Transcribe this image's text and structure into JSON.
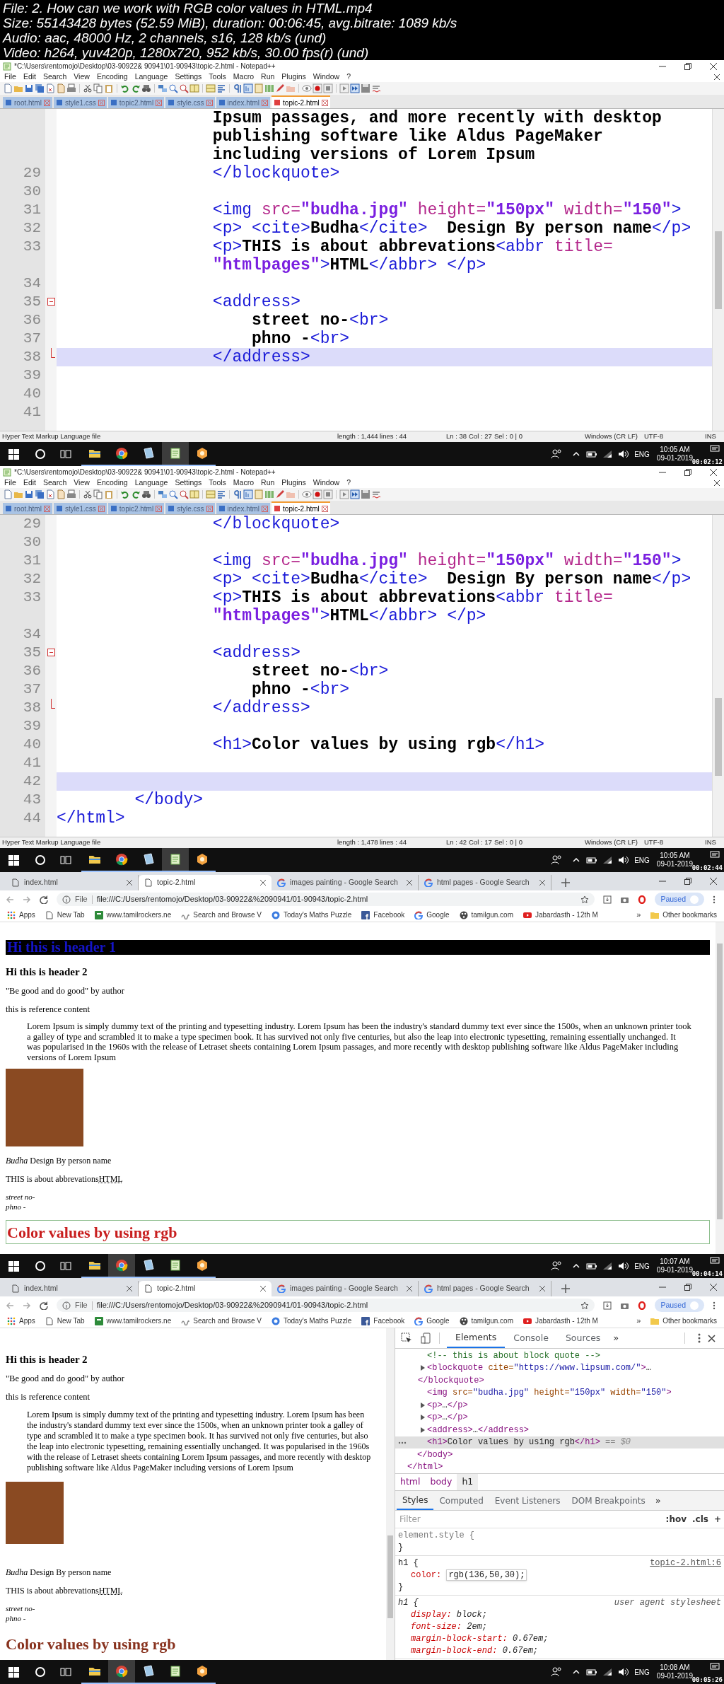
{
  "file_info": [
    "File: 2. How can we work with RGB color values in HTML.mp4",
    "Size: 55143428 bytes (52.59 MiB), duration: 00:06:45, avg.bitrate: 1089 kb/s",
    "Audio: aac, 48000 Hz, 2 channels, s16, 128 kb/s (und)",
    "Video: h264, yuv420p, 1280x720, 952 kb/s, 30.00 fps(r) (und)"
  ],
  "frames": [
    {
      "kind": "notepad",
      "window_title": "*C:\\Users\\rentomojo\\Desktop\\03-90922& 90941\\01-90943\\topic-2.html - Notepad++",
      "menu": [
        "File",
        "Edit",
        "Search",
        "View",
        "Encoding",
        "Language",
        "Settings",
        "Tools",
        "Macro",
        "Run",
        "Plugins",
        "Window",
        "?"
      ],
      "tabs": [
        {
          "label": "root.html",
          "selected": false
        },
        {
          "label": "style1.css",
          "selected": false
        },
        {
          "label": "topic2.html",
          "selected": false
        },
        {
          "label": "style.css",
          "selected": false
        },
        {
          "label": "index.html",
          "selected": false
        },
        {
          "label": "topic-2.html",
          "selected": true
        }
      ],
      "lines": [
        {
          "kind": "code",
          "code": "                Ipsum passages, and more recently with desktop",
          "highlighted": false
        },
        {
          "kind": "code",
          "code": "                publishing software like Aldus PageMaker",
          "highlighted": false
        },
        {
          "kind": "code",
          "code": "                including versions of Lorem Ipsum",
          "highlighted": false
        },
        {
          "kind": "code",
          "number": "29",
          "code": "                </blockquote>",
          "highlighted": false
        },
        {
          "kind": "code",
          "number": "30",
          "highlighted": false
        },
        {
          "kind": "code",
          "number": "31",
          "code": "                <img src=\"budha.jpg\" height=\"150px\" width=\"150\">",
          "highlighted": false
        },
        {
          "kind": "code",
          "number": "32",
          "code": "                <p> <cite>Budha</cite>  Design By person name</p>",
          "highlighted": false
        },
        {
          "kind": "code",
          "number": "33",
          "code": "                <p>THIS is about abbrevations<abbr title=",
          "highlighted": false
        },
        {
          "kind": "code",
          "code": "                \"htmlpages\">HTML</abbr> </p>",
          "highlighted": false
        },
        {
          "kind": "code",
          "number": "34",
          "highlighted": false
        },
        {
          "kind": "fold_start",
          "number": "35",
          "code": "                <address>",
          "highlighted": false
        },
        {
          "kind": "code",
          "number": "36",
          "code": "                    street no-<br>",
          "highlighted": false
        },
        {
          "kind": "code",
          "number": "37",
          "code": "                    phno -<br>",
          "highlighted": false
        },
        {
          "kind": "fold_end",
          "number": "38",
          "code": "                </address>",
          "highlighted": true
        },
        {
          "kind": "code",
          "number": "39",
          "highlighted": false
        },
        {
          "kind": "code",
          "number": "40",
          "highlighted": false
        },
        {
          "kind": "code",
          "number": "41",
          "highlighted": false
        }
      ],
      "status": [
        "Hyper Text Markup Language file",
        "length : 1,444",
        "lines : 44",
        "Ln : 38",
        "Col : 27",
        "Sel : 0 | 0",
        "Windows (CR LF)",
        "UTF-8",
        "INS"
      ],
      "taskbar": {
        "apps": [
          {
            "kind": "explorer",
            "selected": false
          },
          {
            "kind": "chrome",
            "selected": false
          },
          {
            "kind": "tablet",
            "selected": false
          },
          {
            "kind": "notepad",
            "selected": true
          },
          {
            "kind": "hexagon",
            "selected": false
          }
        ],
        "language": "ENG",
        "time": "10:05 AM",
        "date": "09-01-2019"
      },
      "timestamp": "00:02:12"
    },
    {
      "kind": "notepad",
      "window_title": "*C:\\Users\\rentomojo\\Desktop\\03-90922& 90941\\01-90943\\topic-2.html - Notepad++",
      "menu": [
        "File",
        "Edit",
        "Search",
        "View",
        "Encoding",
        "Language",
        "Settings",
        "Tools",
        "Macro",
        "Run",
        "Plugins",
        "Window",
        "?"
      ],
      "tabs": [
        {
          "label": "root.html",
          "selected": false
        },
        {
          "label": "style1.css",
          "selected": false
        },
        {
          "label": "topic2.html",
          "selected": false
        },
        {
          "label": "style.css",
          "selected": false
        },
        {
          "label": "index.html",
          "selected": false
        },
        {
          "label": "topic-2.html",
          "selected": true
        }
      ],
      "lines": [
        {
          "kind": "code",
          "number": "29",
          "code": "                </blockquote>",
          "highlighted": false
        },
        {
          "kind": "code",
          "number": "30",
          "highlighted": false
        },
        {
          "kind": "code",
          "number": "31",
          "code": "                <img src=\"budha.jpg\" height=\"150px\" width=\"150\">",
          "highlighted": false
        },
        {
          "kind": "code",
          "number": "32",
          "code": "                <p> <cite>Budha</cite>  Design By person name</p>",
          "highlighted": false
        },
        {
          "kind": "code",
          "number": "33",
          "code": "                <p>THIS is about abbrevations<abbr title=",
          "highlighted": false
        },
        {
          "kind": "code",
          "code": "                \"htmlpages\">HTML</abbr> </p>",
          "highlighted": false
        },
        {
          "kind": "code",
          "number": "34",
          "highlighted": false
        },
        {
          "kind": "fold_start",
          "number": "35",
          "code": "                <address>",
          "highlighted": false
        },
        {
          "kind": "code",
          "number": "36",
          "code": "                    street no-<br>",
          "highlighted": false
        },
        {
          "kind": "code",
          "number": "37",
          "code": "                    phno -<br>",
          "highlighted": false
        },
        {
          "kind": "fold_end",
          "number": "38",
          "code": "                </address>",
          "highlighted": false
        },
        {
          "kind": "code",
          "number": "39",
          "highlighted": false
        },
        {
          "kind": "code",
          "number": "40",
          "code": "                <h1>Color values by using rgb</h1>",
          "highlighted": false
        },
        {
          "kind": "code",
          "number": "41",
          "highlighted": false
        },
        {
          "kind": "code",
          "number": "42",
          "highlighted": true
        },
        {
          "kind": "code",
          "number": "43",
          "code": "        </body>",
          "highlighted": false
        },
        {
          "kind": "code",
          "number": "44",
          "code": "</html>",
          "highlighted": false
        }
      ],
      "status": [
        "Hyper Text Markup Language file",
        "length : 1,478",
        "lines : 44",
        "Ln : 42",
        "Col : 17",
        "Sel : 0 | 0",
        "Windows (CR LF)",
        "UTF-8",
        "INS"
      ],
      "taskbar": {
        "apps": [
          {
            "kind": "explorer",
            "selected": false
          },
          {
            "kind": "chrome",
            "selected": false
          },
          {
            "kind": "tablet",
            "selected": false
          },
          {
            "kind": "notepad",
            "selected": true
          },
          {
            "kind": "hexagon",
            "selected": false
          }
        ],
        "language": "ENG",
        "time": "10:05 AM",
        "date": "09-01-2019"
      },
      "timestamp": "00:02:44"
    },
    {
      "kind": "chrome",
      "tabs": [
        {
          "label": "index.html",
          "selected": false
        },
        {
          "label": "topic-2.html",
          "selected": true
        },
        {
          "label": "images painting - Google Search",
          "selected": false
        },
        {
          "label": "html pages - Google Search",
          "selected": false
        }
      ],
      "address": {
        "chip": "File",
        "url": "file:///C:/Users/rentomojo/Desktop/03-90922&%2090941/01-90943/topic-2.html"
      },
      "profile_button": "Paused",
      "bookmarks": [
        "Apps",
        "New Tab",
        "www.tamilrockers.ne",
        "Search and Browse V",
        "Today's Maths Puzzle",
        "Facebook",
        "Google",
        "tamilgun.com",
        "Jabardasth - 12th M"
      ],
      "bookmarks_more": "»",
      "other_bookmarks": "Other bookmarks",
      "page": [
        {
          "kind": "h1_bar",
          "text": "Hi this is header 1"
        },
        {
          "kind": "h2",
          "text": "Hi this is header 2"
        },
        {
          "kind": "p",
          "text": "\"Be good and do good\" by author"
        },
        {
          "kind": "p",
          "text": "this is reference content"
        },
        {
          "kind": "blockquote",
          "text": "Lorem Ipsum is simply dummy text of the printing and typesetting industry. Lorem Ipsum has been the industry's standard dummy text ever since the 1500s, when an unknown printer took a galley of type and scrambled it to make a type specimen book. It has survived not only five centuries, but also the leap into electronic typesetting, remaining essentially unchanged. It was popularised in the 1960s with the release of Letraset sheets containing Lorem Ipsum passages, and more recently with desktop publishing software like Aldus PageMaker including versions of Lorem Ipsum"
        },
        {
          "kind": "image"
        },
        {
          "kind": "cite_line",
          "text": "*Budha* Design By person name"
        },
        {
          "kind": "abbr_line",
          "text": "THIS is about abbrevations",
          "abbr": "HTML"
        },
        {
          "kind": "address",
          "lines": [
            "street no-",
            "phno -"
          ]
        },
        {
          "kind": "h1",
          "text": "Color values by using rgb",
          "color": "#c81e1e",
          "outlined": true
        }
      ],
      "taskbar": {
        "apps": [
          {
            "kind": "explorer",
            "selected": false
          },
          {
            "kind": "chrome",
            "selected": true
          },
          {
            "kind": "tablet",
            "selected": false
          },
          {
            "kind": "notepad",
            "selected": false
          },
          {
            "kind": "hexagon",
            "selected": false
          }
        ],
        "language": "ENG",
        "time": "10:07 AM",
        "date": "09-01-2019"
      },
      "timestamp": "00:04:14"
    },
    {
      "kind": "chrome",
      "tabs": [
        {
          "label": "index.html",
          "selected": false
        },
        {
          "label": "topic-2.html",
          "selected": true
        },
        {
          "label": "images painting - Google Search",
          "selected": false
        },
        {
          "label": "html pages - Google Search",
          "selected": false
        }
      ],
      "address": {
        "chip": "File",
        "url": "file:///C:/Users/rentomojo/Desktop/03-90922&%2090941/01-90943/topic-2.html"
      },
      "profile_button": "Paused",
      "bookmarks": [
        "Apps",
        "New Tab",
        "www.tamilrockers.ne",
        "Search and Browse V",
        "Today's Maths Puzzle",
        "Facebook",
        "Google",
        "tamilgun.com",
        "Jabardasth - 12th M"
      ],
      "bookmarks_more": "»",
      "other_bookmarks": "Other bookmarks",
      "page": [
        {
          "kind": "h2",
          "text": "Hi this is header 2"
        },
        {
          "kind": "p",
          "text": "\"Be good and do good\" by author"
        },
        {
          "kind": "p",
          "text": "this is reference content"
        },
        {
          "kind": "blockquote",
          "text": "Lorem Ipsum is simply dummy text of the printing and typesetting industry. Lorem Ipsum has been the industry's standard dummy text ever since the 1500s, when an unknown printer took a galley of type and scrambled it to make a type specimen book. It has survived not only five centuries, but also the leap into electronic typesetting, remaining essentially unchanged. It was popularised in the 1960s with the release of Letraset sheets containing Lorem Ipsum passages, and more recently with desktop publishing software like Aldus PageMaker including versions of Lorem Ipsum"
        },
        {
          "kind": "image"
        },
        {
          "kind": "cite_line",
          "text": "*Budha* Design By person name"
        },
        {
          "kind": "abbr_line",
          "text": "THIS is about abbrevations",
          "abbr": "HTML"
        },
        {
          "kind": "address",
          "lines": [
            "street no-",
            "phno -"
          ]
        },
        {
          "kind": "h1",
          "text": "Color values by using rgb",
          "color": "#88321e",
          "outlined": false
        }
      ],
      "devtools": {
        "tabs": [
          {
            "label": "Elements",
            "selected": true
          },
          {
            "label": "Console",
            "selected": false
          },
          {
            "label": "Sources",
            "selected": false
          }
        ],
        "tabs_more": "»",
        "dom_tree": [
          {
            "closing": "</html>",
            "expandable": false,
            "selected": false,
            "children": [
              {
                "closing": "</body>",
                "expandable": false,
                "selected": false,
                "children": [
                  {
                    "code": "<!-- this is about block quote -->",
                    "expandable": false,
                    "selected": false
                  },
                  {
                    "code": "<blockquote cite=\"https://www.lipsum.com/\">…",
                    "closing": "</blockquote>",
                    "expandable": true,
                    "selected": false
                  },
                  {
                    "code": "<img src=\"budha.jpg\" height=\"150px\" width=\"150\">",
                    "expandable": false,
                    "selected": false
                  },
                  {
                    "code": "<p>…</p>",
                    "expandable": true,
                    "selected": false
                  },
                  {
                    "code": "<p>…</p>",
                    "expandable": true,
                    "selected": false
                  },
                  {
                    "code": "<address>…</address>",
                    "expandable": true,
                    "selected": false
                  },
                  {
                    "code": "<h1>Color values by using rgb</h1>",
                    "suffix": "== $0",
                    "expandable": false,
                    "selected": true
                  }
                ]
              }
            ]
          }
        ],
        "breadcrumbs": [
          {
            "label": "html",
            "selected": false
          },
          {
            "label": "body",
            "selected": false
          },
          {
            "label": "h1",
            "selected": true
          }
        ],
        "style_tabs": [
          {
            "label": "Styles",
            "selected": true
          },
          {
            "label": "Computed",
            "selected": false
          },
          {
            "label": "Event Listeners",
            "selected": false
          },
          {
            "label": "DOM Breakpoints",
            "selected": false
          }
        ],
        "style_tabs_more": "»",
        "filter": {
          "placeholder": "Filter",
          "buttons": [
            ":hov",
            ".cls",
            "+"
          ]
        },
        "rules": [
          {
            "kind": "inline",
            "selector": "element.style {",
            "closing": "}"
          },
          {
            "kind": "author",
            "selector": "h1 {",
            "source": "topic-2.html:6",
            "declarations": [
              {
                "property": "color:",
                "value": "rgb(136,50,30);",
                "editing": true
              }
            ],
            "closing": "}"
          },
          {
            "kind": "user_agent",
            "selector": "h1 {",
            "source": "user agent stylesheet",
            "declarations": [
              {
                "property": "display:",
                "value": "block;",
                "editing": false
              },
              {
                "property": "font-size:",
                "value": "2em;",
                "editing": false
              },
              {
                "property": "margin-block-start:",
                "value": "0.67em;",
                "editing": false
              },
              {
                "property": "margin-block-end:",
                "value": "0.67em;",
                "editing": false
              }
            ]
          }
        ]
      },
      "taskbar": {
        "apps": [
          {
            "kind": "explorer",
            "selected": false
          },
          {
            "kind": "chrome",
            "selected": true
          },
          {
            "kind": "tablet",
            "selected": false
          },
          {
            "kind": "notepad",
            "selected": false
          },
          {
            "kind": "hexagon",
            "selected": false
          }
        ],
        "language": "ENG",
        "time": "10:08 AM",
        "date": "09-01-2019"
      },
      "timestamp": "00:05:26"
    }
  ]
}
